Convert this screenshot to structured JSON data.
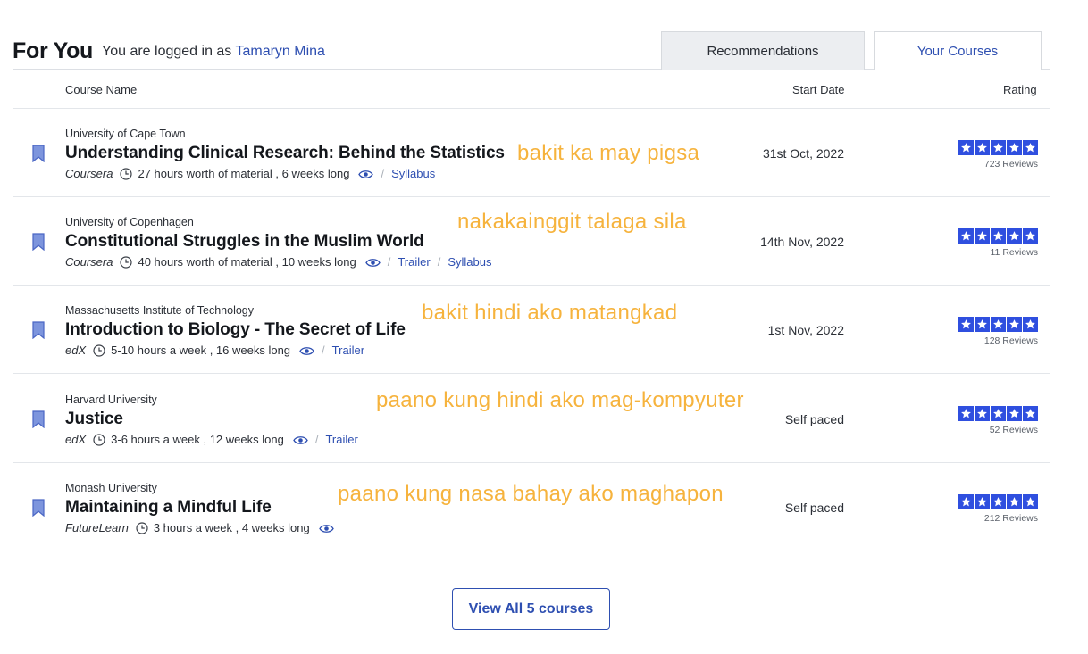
{
  "header": {
    "title": "For You",
    "login_prefix": "You are logged in as",
    "user_name": "Tamaryn Mina",
    "tabs": {
      "recommendations": "Recommendations",
      "your_courses": "Your Courses"
    }
  },
  "columns": {
    "name": "Course Name",
    "start": "Start Date",
    "rating": "Rating"
  },
  "colors": {
    "accent": "#2e4fb1",
    "star": "#2f4fdf",
    "overlay": "#f6b33d",
    "bookmark": "#7d95dd"
  },
  "courses": [
    {
      "university": "University of Cape Town",
      "title": "Understanding Clinical Research: Behind the Statistics",
      "provider": "Coursera",
      "effort": "27 hours worth of material , 6 weeks long",
      "links": [
        "Syllabus"
      ],
      "start_date": "31st Oct, 2022",
      "rating_stars": 5,
      "reviews": "723 Reviews",
      "overlay": "bakit ka may pigsa"
    },
    {
      "university": "University of Copenhagen",
      "title": "Constitutional Struggles in the Muslim World",
      "provider": "Coursera",
      "effort": "40 hours worth of material , 10 weeks long",
      "links": [
        "Trailer",
        "Syllabus"
      ],
      "start_date": "14th Nov, 2022",
      "rating_stars": 5,
      "reviews": "11 Reviews",
      "overlay": "nakakainggit talaga sila"
    },
    {
      "university": "Massachusetts Institute of Technology",
      "title": "Introduction to Biology - The Secret of Life",
      "provider": "edX",
      "effort": "5-10 hours a week , 16 weeks long",
      "links": [
        "Trailer"
      ],
      "start_date": "1st Nov, 2022",
      "rating_stars": 5,
      "reviews": "128 Reviews",
      "overlay": "bakit hindi ako matangkad"
    },
    {
      "university": "Harvard University",
      "title": "Justice",
      "provider": "edX",
      "effort": "3-6 hours a week , 12 weeks long",
      "links": [
        "Trailer"
      ],
      "start_date": "Self paced",
      "rating_stars": 5,
      "reviews": "52 Reviews",
      "overlay": "paano kung hindi ako mag-kompyuter"
    },
    {
      "university": "Monash University",
      "title": "Maintaining a Mindful Life",
      "provider": "FutureLearn",
      "effort": "3 hours a week , 4 weeks long",
      "links": [],
      "start_date": "Self paced",
      "rating_stars": 5,
      "reviews": "212 Reviews",
      "overlay": "paano kung nasa bahay ako maghapon"
    }
  ],
  "view_all": {
    "prefix": "View All",
    "count": "5",
    "suffix": "courses"
  }
}
